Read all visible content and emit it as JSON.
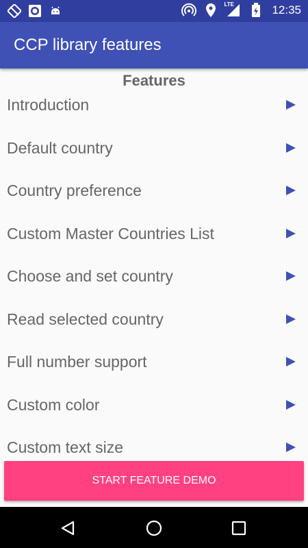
{
  "status_bar": {
    "time": "12:35",
    "network_label": "LTE",
    "left_icons": [
      "sync-off-icon",
      "record-icon",
      "android-icon"
    ],
    "right_icons": [
      "hotspot-icon",
      "location-icon",
      "signal-icon",
      "battery-icon"
    ]
  },
  "app_bar": {
    "title": "CCP library features"
  },
  "features": {
    "heading": "Features",
    "items": [
      {
        "label": "Introduction"
      },
      {
        "label": "Default country"
      },
      {
        "label": "Country preference"
      },
      {
        "label": "Custom Master Countries List"
      },
      {
        "label": "Choose and set country"
      },
      {
        "label": "Read selected country"
      },
      {
        "label": "Full number support"
      },
      {
        "label": "Custom color"
      },
      {
        "label": "Custom text size"
      }
    ]
  },
  "action": {
    "start_label": "START FEATURE DEMO"
  },
  "nav_bar": {
    "icons": [
      "back-icon",
      "home-icon",
      "recents-icon"
    ]
  },
  "colors": {
    "primary": "#3f51b5",
    "primary_dark": "#303f9f",
    "accent": "#ff4081",
    "text": "#666666"
  }
}
